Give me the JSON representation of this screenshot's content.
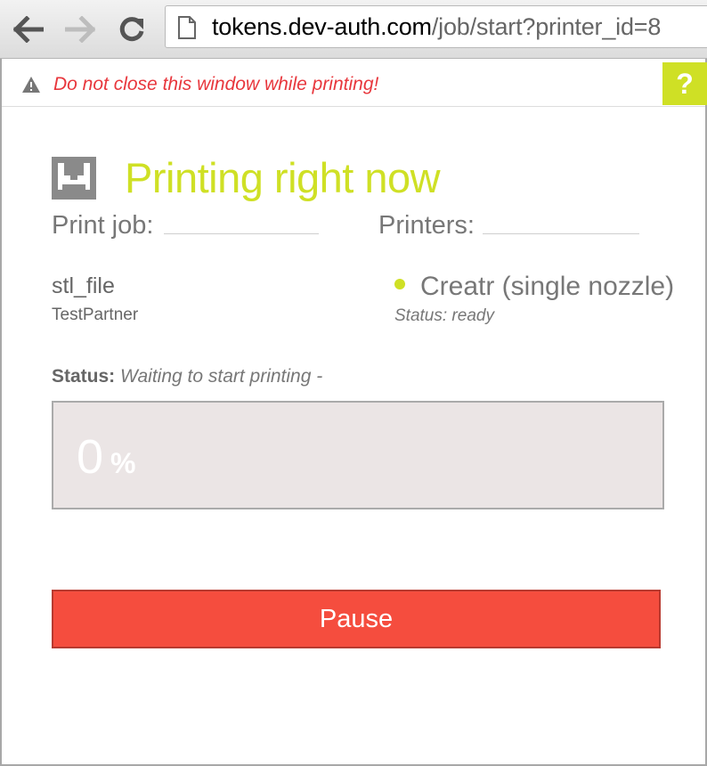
{
  "browser": {
    "url_domain": "tokens.dev-auth.com",
    "url_path": "/job/start?printer_id=8"
  },
  "warning": {
    "text": "Do not close this window while printing!",
    "help_label": "?"
  },
  "colors": {
    "accent": "#cfe025",
    "warning_text": "#e8373d",
    "pause_button": "#f54d3e",
    "progress_bg": "#ebe5e5"
  },
  "main": {
    "title": "Printing right now",
    "print_job_label": "Print job:",
    "printers_label": "Printers:",
    "job": {
      "name": "stl_file",
      "partner": "TestPartner"
    },
    "printer": {
      "name": "Creatr (single nozzle)",
      "status": "Status: ready"
    },
    "status": {
      "label": "Status:",
      "value": "Waiting to start printing -"
    },
    "progress": {
      "value": "0",
      "unit": "%",
      "fraction": 0
    },
    "pause_label": "Pause"
  }
}
